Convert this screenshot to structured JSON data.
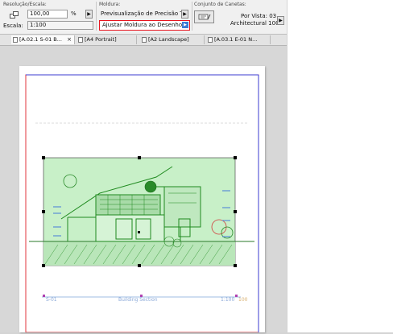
{
  "toolbar": {
    "resolution_label": "Resolução/Escala:",
    "resolution_value": "100,00",
    "resolution_unit": "%",
    "scale_label": "Escala:",
    "scale_value": "1:100",
    "frame_label": "Moldura:",
    "frame_preview_value": "Previsualização de Precisão T...",
    "frame_fit_value": "Ajustar Moldura ao Desenho",
    "pen_set_label": "Conjunto de Canetas:",
    "pen_set_by_view": "Por Vista: 03",
    "pen_set_name": "Architectural 100"
  },
  "tabs": [
    {
      "label": "[A.02.1 S-01 B..."
    },
    {
      "label": "[A4 Portrait]"
    },
    {
      "label": "[A2 Landscape]"
    },
    {
      "label": "[A.03.1 E-01 N..."
    }
  ],
  "drawing": {
    "id_label": "S-01",
    "title_label": "Building Section",
    "scale_label": "1:100",
    "scale_extra": "100"
  },
  "colors": {
    "selection_green": "#c8f0c8",
    "drawing_green": "#1f8a1f",
    "sheet_border_red": "#e0343e",
    "sheet_border_blue": "#3b3bd0",
    "highlight_red": "#e8151f",
    "button_blue": "#3a7bd5"
  },
  "icons": {
    "zoom_icon": "magnify-zoom-icon",
    "tab_close": "close-icon",
    "pen_set_icon": "pen-set-icon",
    "arrow": "play-arrow-icon"
  }
}
